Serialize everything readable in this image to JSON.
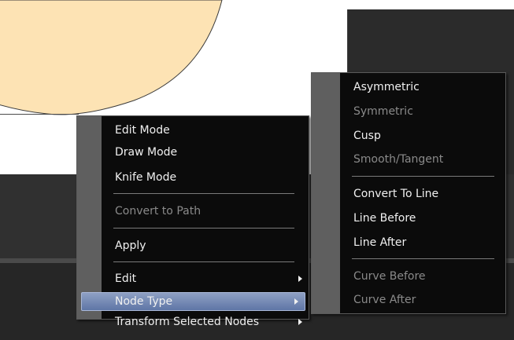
{
  "context_menu": {
    "items": [
      {
        "id": "edit_mode",
        "label": "Edit Mode",
        "enabled": true
      },
      {
        "id": "draw_mode",
        "label": "Draw Mode",
        "enabled": true
      },
      {
        "id": "knife_mode",
        "label": "Knife Mode",
        "enabled": true
      },
      {
        "id": "convert_to_path",
        "label": "Convert to Path",
        "enabled": false
      },
      {
        "id": "apply",
        "label": "Apply",
        "enabled": true
      },
      {
        "id": "edit",
        "label": "Edit",
        "enabled": true,
        "submenu": true
      },
      {
        "id": "node_type",
        "label": "Node Type",
        "enabled": true,
        "submenu": true,
        "highlighted": true
      },
      {
        "id": "transform_selected_nodes",
        "label": "Transform Selected Nodes",
        "enabled": true,
        "submenu": true
      }
    ]
  },
  "node_type_submenu": {
    "items": [
      {
        "id": "asymmetric",
        "label": "Asymmetric",
        "enabled": true
      },
      {
        "id": "symmetric",
        "label": "Symmetric",
        "enabled": false
      },
      {
        "id": "cusp",
        "label": "Cusp",
        "enabled": true
      },
      {
        "id": "smooth_tangent",
        "label": "Smooth/Tangent",
        "enabled": false
      },
      {
        "id": "convert_to_line",
        "label": "Convert To Line",
        "enabled": true
      },
      {
        "id": "line_before",
        "label": "Line Before",
        "enabled": true
      },
      {
        "id": "line_after",
        "label": "Line After",
        "enabled": true
      },
      {
        "id": "curve_before",
        "label": "Curve Before",
        "enabled": false
      },
      {
        "id": "curve_after",
        "label": "Curve After",
        "enabled": false
      }
    ]
  },
  "colors": {
    "shape_fill": "#fde3b4",
    "menu_background": "#0b0b0b",
    "menu_gutter": "#5f5f5f",
    "highlight": "#6f85b3",
    "disabled_text": "#8a8a8a"
  }
}
